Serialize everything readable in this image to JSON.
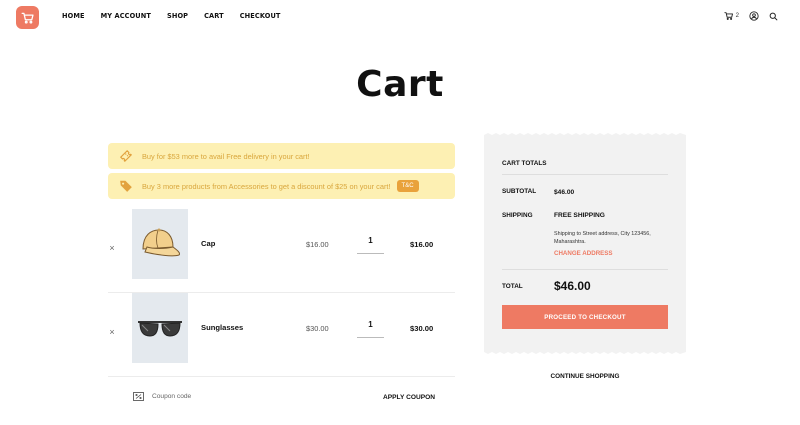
{
  "colors": {
    "accent": "#ee7a63",
    "notice_bg": "#fdf0b3",
    "notice_text": "#d9a63c",
    "badge": "#e9a23b",
    "panel_bg": "#f2f2f2"
  },
  "header": {
    "logo_icon": "shopping-cart-icon",
    "nav": [
      "HOME",
      "MY ACCOUNT",
      "SHOP",
      "CART",
      "CHECKOUT"
    ],
    "cart_count": "2",
    "icons": [
      "cart-icon",
      "user-icon",
      "search-icon"
    ]
  },
  "page": {
    "title": "Cart"
  },
  "notices": [
    {
      "icon": "ticket-icon",
      "text": "Buy for $53 more to avail Free delivery in your cart!"
    },
    {
      "icon": "tag-icon",
      "text": "Buy 3 more products from Accessories to get a discount of $25 on your cart!",
      "badge": "T&C"
    }
  ],
  "items": [
    {
      "remove": "×",
      "name": "Cap",
      "price": "$16.00",
      "qty": "1",
      "subtotal": "$16.00",
      "image": "cap"
    },
    {
      "remove": "×",
      "name": "Sunglasses",
      "price": "$30.00",
      "qty": "1",
      "subtotal": "$30.00",
      "image": "sunglasses"
    }
  ],
  "coupon": {
    "placeholder": "Coupon code",
    "apply_label": "APPLY COUPON"
  },
  "totals": {
    "heading": "CART TOTALS",
    "subtotal_label": "SUBTOTAL",
    "subtotal_value": "$46.00",
    "shipping_label": "SHIPPING",
    "shipping_value": "FREE SHIPPING",
    "shipping_address": "Shipping to Street address, City 123456, Maharashtra.",
    "change_address": "CHANGE ADDRESS",
    "total_label": "TOTAL",
    "total_value": "$46.00",
    "checkout_label": "PROCEED TO CHECKOUT"
  },
  "continue_label": "CONTINUE SHOPPING"
}
